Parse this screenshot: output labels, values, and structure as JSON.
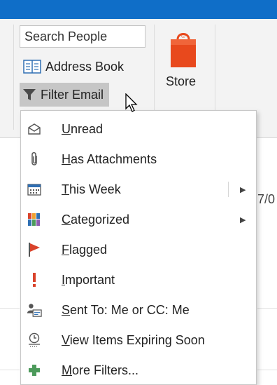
{
  "ribbon": {
    "search_placeholder": "Search People",
    "address_book_label": "Address Book",
    "filter_email_label": "Filter Email",
    "store_label": "Store"
  },
  "menu": {
    "items": [
      {
        "pre": "",
        "ul": "U",
        "post": "nread",
        "icon": "envelope-open-icon"
      },
      {
        "pre": "",
        "ul": "H",
        "post": "as Attachments",
        "icon": "paperclip-icon"
      },
      {
        "pre": "",
        "ul": "T",
        "post": "his Week",
        "icon": "calendar-week-icon",
        "submenu": true
      },
      {
        "pre": "",
        "ul": "C",
        "post": "ategorized",
        "icon": "categories-icon",
        "submenu": true
      },
      {
        "pre": "",
        "ul": "F",
        "post": "lagged",
        "icon": "flag-icon"
      },
      {
        "pre": "",
        "ul": "I",
        "post": "mportant",
        "icon": "exclamation-icon"
      },
      {
        "pre": "",
        "ul": "S",
        "post": "ent To: Me or CC: Me",
        "icon": "sent-to-me-icon"
      },
      {
        "pre": "",
        "ul": "V",
        "post": "iew Items Expiring Soon",
        "icon": "expiring-clock-icon"
      },
      {
        "pre": "",
        "ul": "M",
        "post": "ore Filters...",
        "icon": "plus-icon"
      }
    ]
  },
  "background": {
    "partial_text": "7/0"
  },
  "colors": {
    "titlebar": "#0f6ec8",
    "accent_orange": "#e8491d",
    "flag_red": "#d9432b",
    "plus_green": "#4c9a5b"
  }
}
